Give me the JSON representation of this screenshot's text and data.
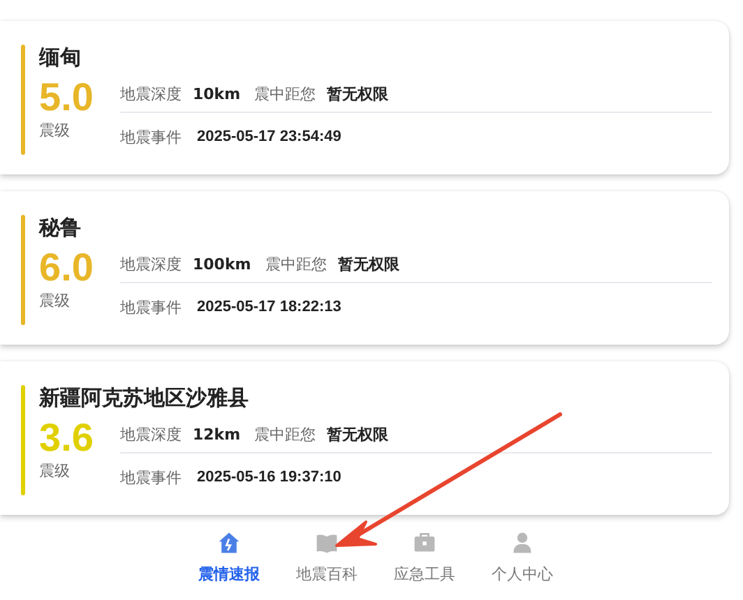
{
  "quakes": [
    {
      "place": "缅甸",
      "magnitude": "5.0",
      "magnitude_label": "震级",
      "color": "#e8b628",
      "depth_label": "地震深度",
      "depth": "10km",
      "distance_label": "震中距您",
      "distance": "暂无权限",
      "time_label": "地震事件",
      "time": "2025-05-17 23:54:49"
    },
    {
      "place": "秘鲁",
      "magnitude": "6.0",
      "magnitude_label": "震级",
      "color": "#e8b628",
      "depth_label": "地震深度",
      "depth": "100km",
      "distance_label": "震中距您",
      "distance": "暂无权限",
      "time_label": "地震事件",
      "time": "2025-05-17 18:22:13"
    },
    {
      "place": "新疆阿克苏地区沙雅县",
      "magnitude": "3.6",
      "magnitude_label": "震级",
      "color": "#e0d000",
      "depth_label": "地震深度",
      "depth": "12km",
      "distance_label": "震中距您",
      "distance": "暂无权限",
      "time_label": "地震事件",
      "time": "2025-05-16 19:37:10"
    }
  ],
  "nav": [
    {
      "label": "震情速报",
      "kind": "home",
      "selected": true
    },
    {
      "label": "地震百科",
      "kind": "book",
      "selected": false
    },
    {
      "label": "应急工具",
      "kind": "toolbox",
      "selected": false
    },
    {
      "label": "个人中心",
      "kind": "person",
      "selected": false
    }
  ]
}
